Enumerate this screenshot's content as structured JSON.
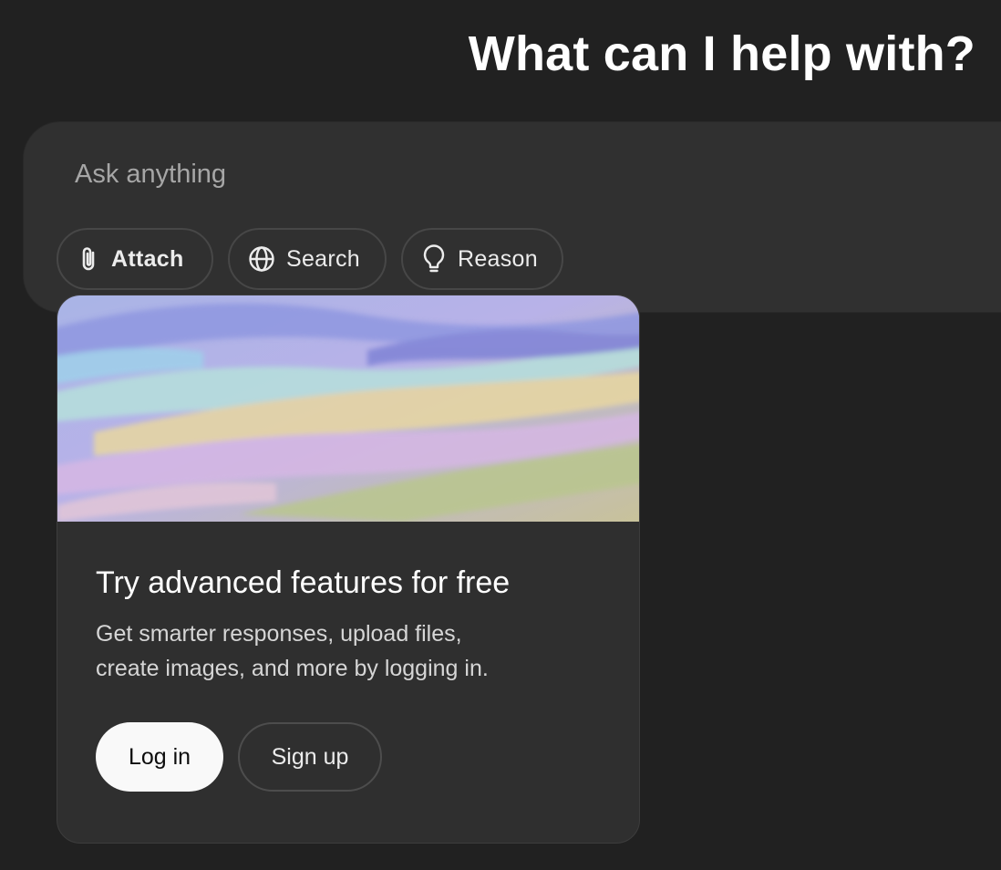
{
  "header": {
    "title": "What can I help with?"
  },
  "composer": {
    "placeholder": "Ask anything",
    "tools": [
      {
        "label": "Attach",
        "icon": "paperclip-icon"
      },
      {
        "label": "Search",
        "icon": "globe-icon"
      },
      {
        "label": "Reason",
        "icon": "lightbulb-icon"
      }
    ]
  },
  "promo_card": {
    "banner_image": "pastel-brushstroke-artwork",
    "title": "Try advanced features for free",
    "body_line_1": "Get smarter responses, upload files,",
    "body_line_2": "create images, and more by logging in.",
    "login_label": "Log in",
    "signup_label": "Sign up"
  },
  "colors": {
    "page_background": "#212121",
    "composer_background": "#303030",
    "card_background": "#2f2f2f",
    "login_button_background": "#f9f9f9",
    "text_primary": "#ffffff",
    "placeholder_text": "#a6a6a6"
  }
}
